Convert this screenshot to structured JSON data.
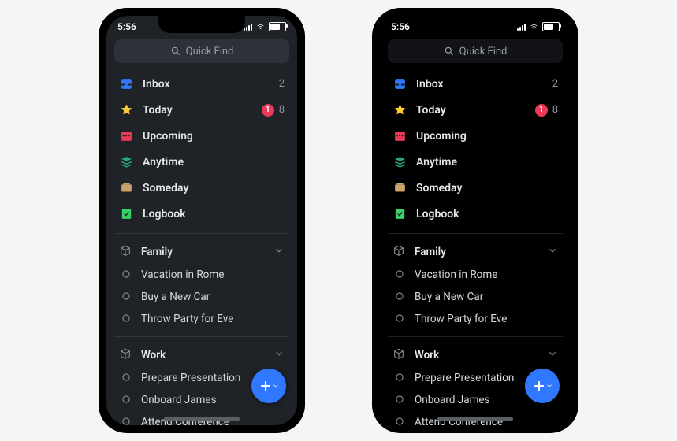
{
  "time": "5:56",
  "search_placeholder": "Quick Find",
  "smart": [
    {
      "id": "inbox",
      "label": "Inbox",
      "count": "2",
      "badge": ""
    },
    {
      "id": "today",
      "label": "Today",
      "count": "8",
      "badge": "1"
    },
    {
      "id": "upcoming",
      "label": "Upcoming",
      "count": "",
      "badge": ""
    },
    {
      "id": "anytime",
      "label": "Anytime",
      "count": "",
      "badge": ""
    },
    {
      "id": "someday",
      "label": "Someday",
      "count": "",
      "badge": ""
    },
    {
      "id": "logbook",
      "label": "Logbook",
      "count": "",
      "badge": ""
    }
  ],
  "areas": [
    {
      "id": "family",
      "label": "Family",
      "projects": [
        "Vacation in Rome",
        "Buy a New Car",
        "Throw Party for Eve"
      ]
    },
    {
      "id": "work",
      "label": "Work",
      "projects": [
        "Prepare Presentation",
        "Onboard James",
        "Attend Conference"
      ]
    }
  ],
  "icons": {
    "search": "search-icon",
    "inbox": "inbox-icon",
    "today": "star-icon",
    "upcoming": "calendar-icon",
    "anytime": "stack-icon",
    "someday": "archive-icon",
    "logbook": "checkbook-icon",
    "area": "cube-icon",
    "project": "progress-circle-icon",
    "chevron": "chevron-down-icon",
    "add": "plus-icon"
  },
  "colors": {
    "inbox": "#2f78ff",
    "today": "#ffcc33",
    "upcoming": "#e93b57",
    "anytime": "#2aa889",
    "someday": "#caa36a",
    "logbook": "#3cd167",
    "fab": "#2f78ff",
    "badge": "#e93b57"
  }
}
